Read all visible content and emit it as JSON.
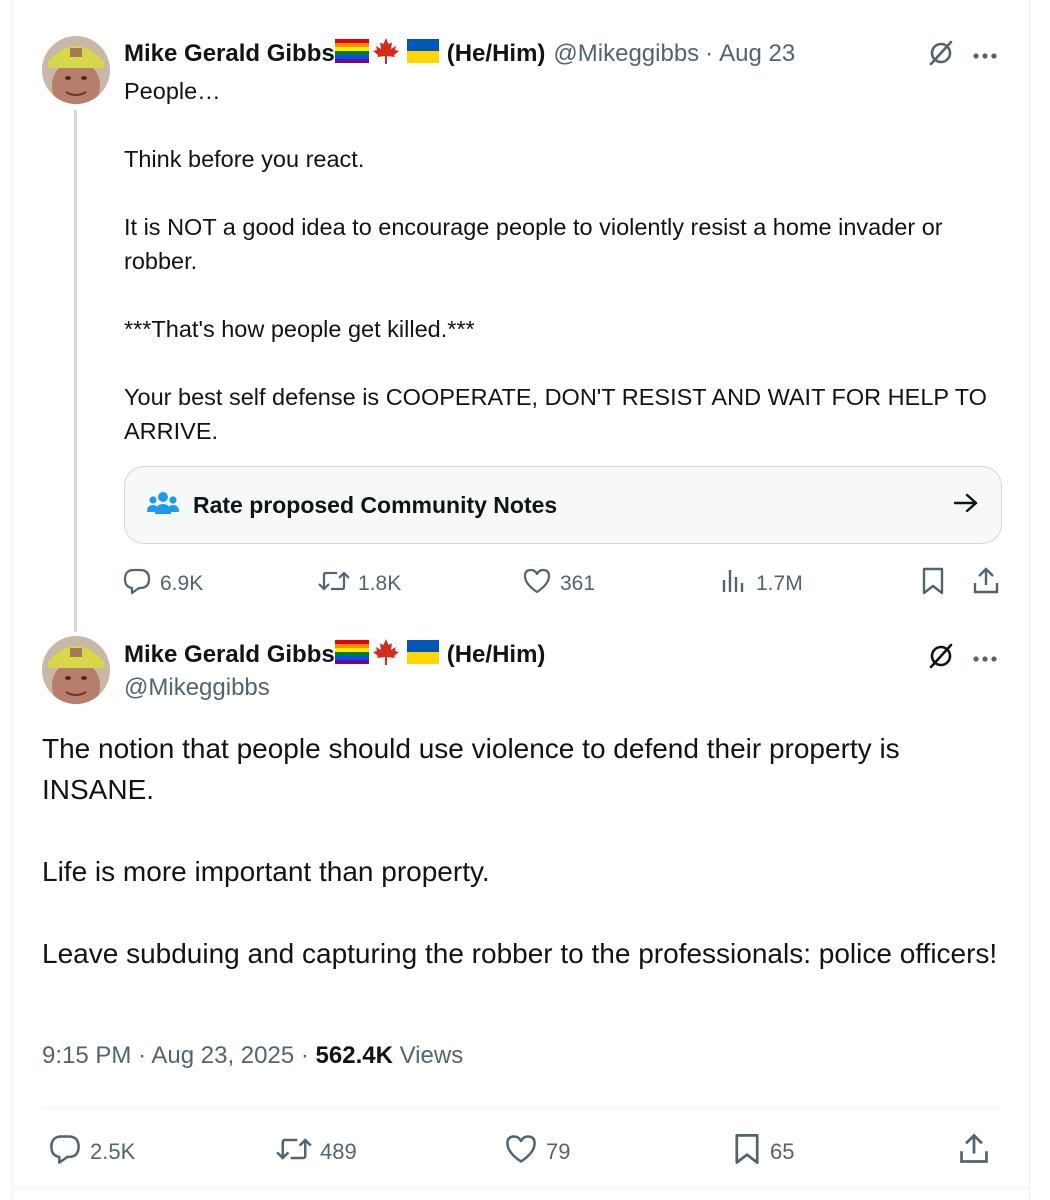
{
  "tweet1": {
    "author_name": "Mike Gerald Gibbs",
    "pronouns": "(He/Him)",
    "handle": "@Mikeggibbs",
    "separator": "·",
    "date": "Aug 23",
    "lines": [
      "People…",
      "",
      "Think before you react.",
      "",
      "It is NOT a good idea to encourage people to violently resist a home invader or robber.",
      "",
      "***That's how people get killed.***",
      "",
      "Your best self defense is COOPERATE, DON'T RESIST AND WAIT FOR HELP TO ARRIVE."
    ],
    "community_notes_label": "Rate proposed Community Notes",
    "replies": "6.9K",
    "reposts": "1.8K",
    "likes": "361",
    "views": "1.7M"
  },
  "tweet2": {
    "author_name": "Mike Gerald Gibbs",
    "pronouns": "(He/Him)",
    "handle": "@Mikeggibbs",
    "paragraphs": [
      "The notion that people should use violence to defend their property is INSANE.",
      "Life is more important than property.",
      "Leave subduing and capturing the robber to the professionals: police officers!"
    ],
    "time": "9:15 PM",
    "date": "Aug 23, 2025",
    "views_count": "562.4K",
    "views_label": "Views",
    "replies": "2.5K",
    "reposts": "489",
    "likes": "79",
    "bookmarks": "65"
  },
  "icons": {
    "flags": [
      "rainbow-flag-icon",
      "maple-leaf-icon",
      "ukraine-flag-icon"
    ],
    "header": [
      "grok-icon",
      "more-icon"
    ],
    "actions": [
      "reply-icon",
      "repost-icon",
      "like-icon",
      "views-icon",
      "bookmark-icon",
      "share-icon"
    ],
    "community_notes": "community-notes-icon",
    "arrow": "arrow-right-icon"
  },
  "colors": {
    "text": "#0f1419",
    "secondary": "#536471",
    "accent": "#1d9bf0",
    "border": "#cfd9de",
    "maple": "#d52b1e",
    "ukraine_blue": "#0057b7",
    "ukraine_yellow": "#ffd700"
  }
}
